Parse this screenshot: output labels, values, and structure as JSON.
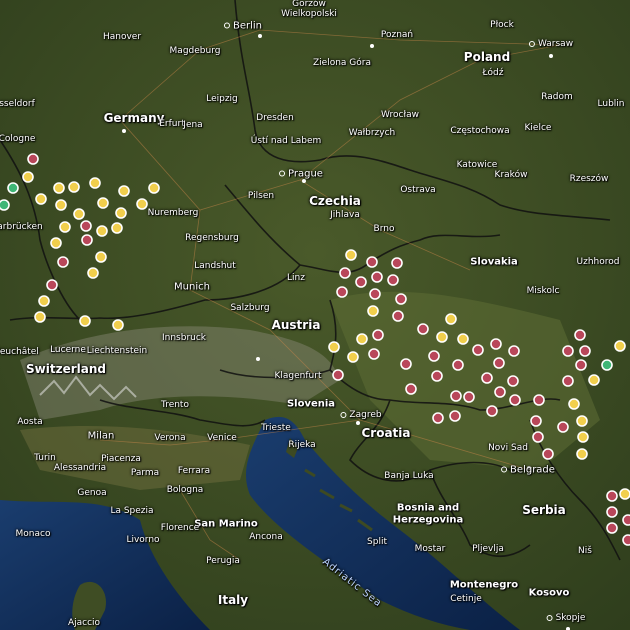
{
  "colors": {
    "marker_red": "#b9475a",
    "marker_yellow": "#f1cf4d",
    "marker_green": "#3fb676",
    "sea": "#0f2a52",
    "border": "#111111"
  },
  "labels": {
    "countries": {
      "germany": "Germany",
      "poland": "Poland",
      "czechia": "Czechia",
      "slovakia": "Slovakia",
      "austria": "Austria",
      "switzerland": "Switzerland",
      "liechtenstein": "Liechtenstein",
      "slovenia": "Slovenia",
      "croatia": "Croatia",
      "bosnia_1": "Bosnia and",
      "bosnia_2": "Herzegovina",
      "serbia": "Serbia",
      "montenegro": "Montenegro",
      "kosovo": "Kosovo",
      "italy": "Italy",
      "san_marino": "San Marino",
      "monaco": "Monaco"
    },
    "sea": {
      "adriatic": "Adriatic Sea"
    },
    "cities": {
      "gorzow": "Gorzów",
      "wielkopolski": "Wielkopolski",
      "berlin": "Berlin",
      "hanover": "Hanover",
      "magdeburg": "Magdeburg",
      "poznan": "Poznań",
      "plock": "Płock",
      "warsaw": "Warsaw",
      "zielona_gora": "Zielona Góra",
      "lodz": "Łódź",
      "radom": "Radom",
      "lublin": "Lublin",
      "dusseldorf": "sseldorf",
      "leipzig": "Leipzig",
      "erfurt": "Erfurt",
      "jena": "Jena",
      "dresden": "Dresden",
      "wroclaw": "Wrocław",
      "walbrzych": "Wałbrzych",
      "czestochowa": "Częstochowa",
      "kielce": "Kielce",
      "cologne": "Cologne",
      "usti": "Ústí nad Labem",
      "katowice": "Katowice",
      "prague": "Prague",
      "ostrava": "Ostrava",
      "krakow": "Kraków",
      "rzeszow": "Rzeszów",
      "pilsen": "Pilsen",
      "nuremberg": "Nuremberg",
      "saarbrucken": "arbrücken",
      "jihlava": "Jihlava",
      "brno": "Brno",
      "regensburg": "Regensburg",
      "landshut": "Landshut",
      "uzhhorod": "Uzhhorod",
      "linz": "Linz",
      "munich": "Munich",
      "salzburg": "Salzburg",
      "miskolc": "Miskolc",
      "innsbruck": "Innsbruck",
      "neuchatel": "Neuchâtel",
      "lucerne": "Lucerne",
      "klagenfurt": "Klagenfurt",
      "trento": "Trento",
      "aosta": "Aosta",
      "milan": "Milan",
      "verona": "Verona",
      "venice": "Venice",
      "trieste": "Trieste",
      "zagreb": "Zagreb",
      "rijeka": "Rijeka",
      "turin": "Turin",
      "alessandria": "Alessandria",
      "piacenza": "Piacenza",
      "parma": "Parma",
      "ferrara": "Ferrara",
      "novi_sad": "Novi Sad",
      "banja_luka": "Banja Luka",
      "bologna": "Bologna",
      "belgrade": "Belgrade",
      "genoa": "Genoa",
      "la_spezia": "La Spezia",
      "livorno": "Livorno",
      "florence": "Florence",
      "ancona": "Ancona",
      "split": "Split",
      "mostar": "Mostar",
      "pljevlja": "Pljevlja",
      "nis": "Niš",
      "perugia": "Perugia",
      "cetinje": "Cetinje",
      "ajaccio": "Ajaccio",
      "skopje": "Skopje"
    }
  }
}
